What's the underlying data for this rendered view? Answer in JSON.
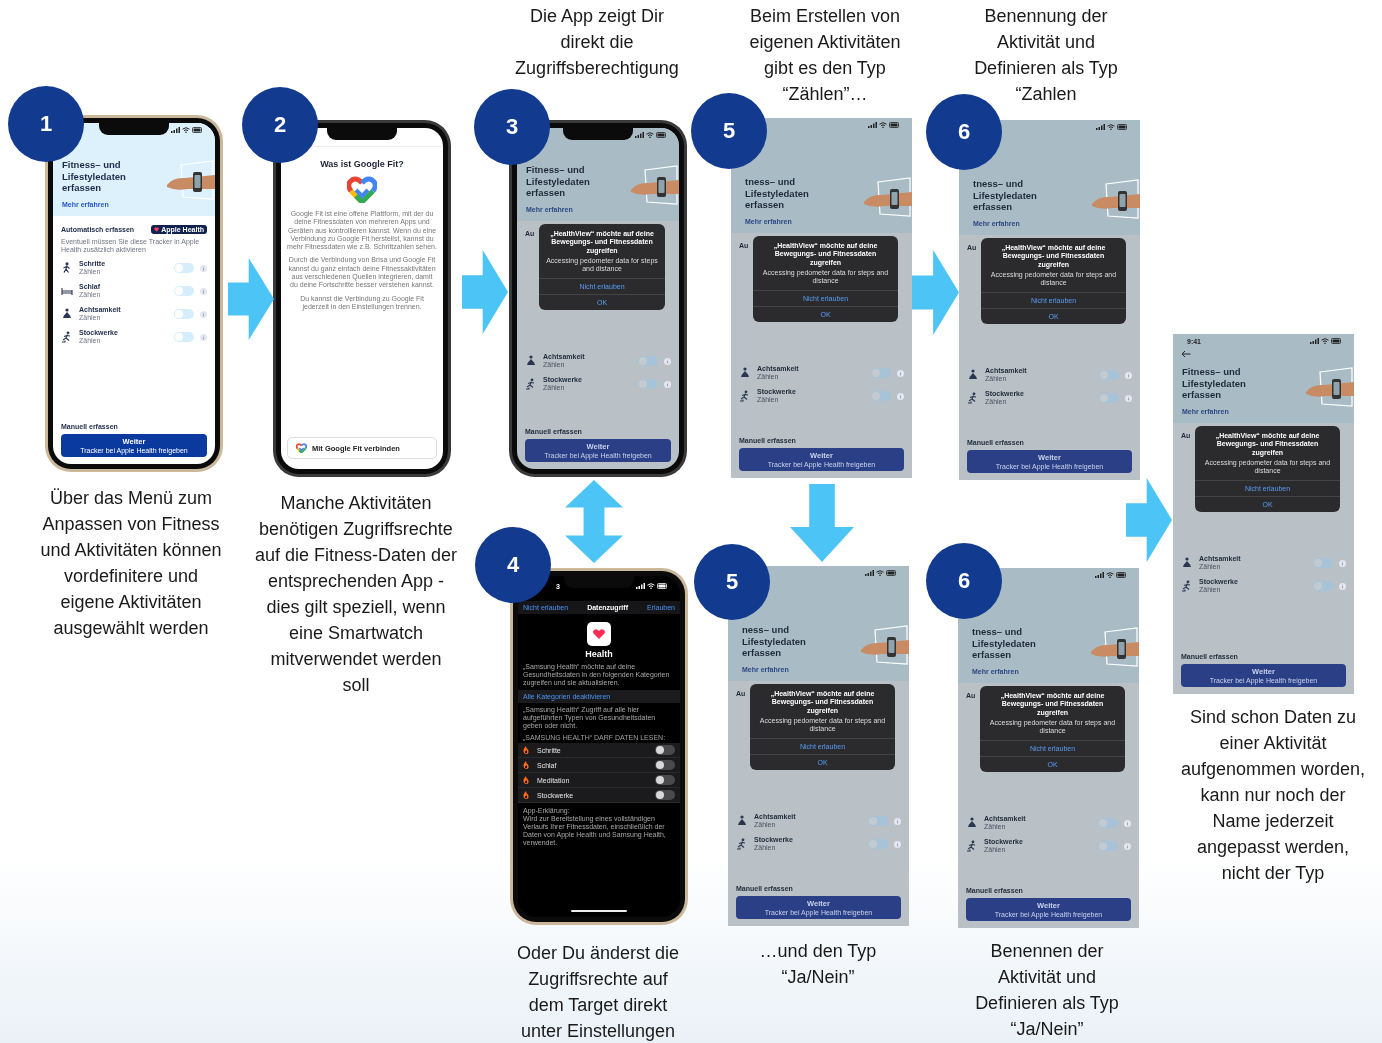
{
  "panels": [
    {
      "badge": "1",
      "caption": "Über das Menü zum\nAnpassen von Fitness\nund Aktivitäten können\nvordefinitere und\neigene Aktivitäten\nausgewählt werden",
      "screen": {
        "kind": "fitness",
        "frame": {
          "color": "#cbb89b"
        },
        "dimmed": false,
        "title": "Fitness– und\nLifestyledaten\nerfassen",
        "link": "Mehr erfahren",
        "auto_heading": "Automatisch erfassen",
        "auto_badge": "Apple Health",
        "auto_note": "Eventuell müssen Sie diese Tracker in Apple Health zusätzlich aktivieren",
        "rows": [
          {
            "kind": "steps",
            "name": "Schritte",
            "sub": "Zählen",
            "on": false
          },
          {
            "kind": "sleep",
            "name": "Schlaf",
            "sub": "Zählen",
            "on": false
          },
          {
            "kind": "mindfulness",
            "name": "Achtsamkeit",
            "sub": "Zählen",
            "on": false
          },
          {
            "kind": "floors",
            "name": "Stockwerke",
            "sub": "Zählen",
            "on": false
          }
        ],
        "manual": "Manuell erfassen",
        "button": "Weiter",
        "button_sub": "Tracker bei Apple Health freigeben"
      }
    },
    {
      "badge": "2",
      "caption": "Manche Aktivitäten\nbenötigen Zugriffsrechte\nauf die Fitness-Daten der\nentsprechenden App -\ndies gilt speziell, wenn\neine Smartwatch\nmitverwendet werden\nsoll",
      "screen": {
        "kind": "googlefit",
        "frame": {
          "color": "#3a3a3c"
        },
        "title": "Was ist Google Fit?",
        "paragraphs": [
          "Google Fit ist eine offene Plattform, mit der du deine Fitnessdaten von mehreren Apps und Geräten aus kontrollieren kannst. Wenn du eine Verbindung zu Google Fit herstellst, kannst du mehr Fitnessdaten wie z.B. Schrittzahlen sehen.",
          "Durch die Verbindung von Brisa und Google Fit kannst du ganz einfach deine Fitnessaktivitäten aus verschiedenen Quellen integrieren, damit du deine Fortschritte besser verstehen kannst.",
          "Du kannst die Verbindung zu Google Fit jederzeit in den Einstellungen trennen."
        ],
        "button": "Mit Google Fit verbinden"
      }
    },
    {
      "badge": "3",
      "caption": "Die App zeigt Dir\ndirekt die\nZugriffsberechtigung",
      "screen": {
        "kind": "fitness",
        "frame": {
          "color": "#3a3a3c"
        },
        "dimmed": true,
        "title": "Fitness– und\nLifestyledaten\nerfassen",
        "link": "Mehr erfahren",
        "auto_heading": "Au",
        "rows": [
          {
            "kind": "mindfulness",
            "name": "Achtsamkeit",
            "sub": "Zählen",
            "on": false
          },
          {
            "kind": "floors",
            "name": "Stockwerke",
            "sub": "Zählen",
            "on": false
          }
        ],
        "manual": "Manuell erfassen",
        "button": "Weiter",
        "button_sub": "Tracker bei Apple Health freigeben",
        "dialog": {
          "title": "„HealthView“ möchte auf deine Bewegungs- und Fitnessdaten zugreifen",
          "sub": "Accessing pedometer data for steps and distance",
          "actions": [
            "Nicht erlauben",
            "OK"
          ]
        }
      }
    },
    {
      "badge": "4",
      "caption": "Oder Du änderst die\nZugriffsrechte auf\ndem Target direkt\nunter Einstellungen",
      "screen": {
        "kind": "health",
        "frame": {
          "color": "#cbb89b"
        },
        "time": "3",
        "nav": [
          "Nicht erlauben",
          "Datenzugriff",
          "Erlauben"
        ],
        "app": "Health",
        "intro": "„Samsung Health“ möchte auf deine Gesundheitsdaten in den folgenden Kategorien zugreifen und sie aktualisieren.",
        "disable_all": "Alle Kategorien deaktivieren",
        "note": "„Samsung Health“ Zugriff auf alle hier aufgeführten Typen von Gesundheitsdaten geben oder nicht.",
        "section": "„SAMSUNG HEALTH“ DARF DATEN LESEN:",
        "rows": [
          {
            "name": "Schritte",
            "on": false
          },
          {
            "name": "Schlaf",
            "on": false
          },
          {
            "name": "Meditation",
            "on": false
          },
          {
            "name": "Stockwerke",
            "on": false
          }
        ],
        "explain_title": "App-Erklärung:",
        "explain": "Wird zur Bereitstellung eines vollständigen Verlaufs Ihrer Fitnessdaten, einschließlich der Daten von Apple Health und Samsung Health, verwendet."
      }
    },
    {
      "badge": "5",
      "caption": "Beim Erstellen von\neigenen Aktivitäten\ngibt es den Typ\n“Zählen”…",
      "screen": {
        "kind": "fitness",
        "dimmed": true,
        "title": "tness– und\nLifestyledaten\nerfassen",
        "link": "Mehr erfahren",
        "auto_heading": "Au",
        "rows": [
          {
            "kind": "mindfulness",
            "name": "Achtsamkeit",
            "sub": "Zählen",
            "on": false
          },
          {
            "kind": "floors",
            "name": "Stockwerke",
            "sub": "Zählen",
            "on": false
          }
        ],
        "manual": "Manuell erfassen",
        "button": "Weiter",
        "button_sub": "Tracker bei Apple Health freigeben",
        "dialog": {
          "title": "„HealthView“ möchte auf deine Bewegungs- und Fitnessdaten zugreifen",
          "sub": "Accessing pedometer data for steps and distance",
          "actions": [
            "Nicht erlauben",
            "OK"
          ]
        }
      }
    },
    {
      "badge": "6",
      "caption": "Benennung der\nAktivität und\nDefinieren als Typ\n“Zahlen",
      "screen": {
        "kind": "fitness",
        "dimmed": true,
        "title": "tness– und\nLifestyledaten\nerfassen",
        "link": "Mehr erfahren",
        "auto_heading": "Au",
        "rows": [
          {
            "kind": "mindfulness",
            "name": "Achtsamkeit",
            "sub": "Zählen",
            "on": false
          },
          {
            "kind": "floors",
            "name": "Stockwerke",
            "sub": "Zählen",
            "on": false
          }
        ],
        "manual": "Manuell erfassen",
        "button": "Weiter",
        "button_sub": "Tracker bei Apple Health freigeben",
        "dialog": {
          "title": "„HealthView“ möchte auf deine Bewegungs- und Fitnessdaten zugreifen",
          "sub": "Accessing pedometer data for steps and distance",
          "actions": [
            "Nicht erlauben",
            "OK"
          ]
        }
      }
    },
    {
      "badge": "5",
      "caption": "…und den Typ\n“Ja/Nein”",
      "screen": {
        "kind": "fitness",
        "dimmed": true,
        "title": "ness– und\nLifestyledaten\nerfassen",
        "link": "Mehr erfahren",
        "auto_heading": "Au",
        "rows": [
          {
            "kind": "mindfulness",
            "name": "Achtsamkeit",
            "sub": "Zählen",
            "on": false
          },
          {
            "kind": "floors",
            "name": "Stockwerke",
            "sub": "Zählen",
            "on": false
          }
        ],
        "manual": "Manuell erfassen",
        "button": "Weiter",
        "button_sub": "Tracker bei Apple Health freigeben",
        "dialog": {
          "title": "„HealthView“ möchte auf deine Bewegungs- und Fitnessdaten zugreifen",
          "sub": "Accessing pedometer data for steps and distance",
          "actions": [
            "Nicht erlauben",
            "OK"
          ]
        }
      }
    },
    {
      "badge": "6",
      "caption": "Benennen der\nAktivität und\nDefinieren als Typ\n“Ja/Nein”",
      "screen": {
        "kind": "fitness",
        "dimmed": true,
        "title": "tness– und\nLifestyledaten\nerfassen",
        "link": "Mehr erfahren",
        "auto_heading": "Au",
        "rows": [
          {
            "kind": "mindfulness",
            "name": "Achtsamkeit",
            "sub": "Zählen",
            "on": false
          },
          {
            "kind": "floors",
            "name": "Stockwerke",
            "sub": "Zählen",
            "on": false
          }
        ],
        "manual": "Manuell erfassen",
        "button": "Weiter",
        "button_sub": "Tracker bei Apple Health freigeben",
        "dialog": {
          "title": "„HealthView“ möchte auf deine Bewegungs- und Fitnessdaten zugreifen",
          "sub": "Accessing pedometer data for steps and distance",
          "actions": [
            "Nicht erlauben",
            "OK"
          ]
        }
      }
    },
    {
      "caption": "Sind schon Daten zu\neiner Aktivität\naufgenommen worden,\nkann nur noch der\nName jederzeit\nangepasst werden,\nnicht der Typ",
      "screen": {
        "kind": "fitness",
        "dimmed": true,
        "time": "9:41",
        "back": true,
        "title": "Fitness– und\nLifestyledaten\nerfassen",
        "link": "Mehr erfahren",
        "auto_heading": "Au",
        "rows": [
          {
            "kind": "mindfulness",
            "name": "Achtsamkeit",
            "sub": "Zählen",
            "on": false
          },
          {
            "kind": "floors",
            "name": "Stockwerke",
            "sub": "Zählen",
            "on": false
          }
        ],
        "manual": "Manuell erfassen",
        "button": "Weiter",
        "button_sub": "Tracker bei Apple Health freigeben",
        "dialog": {
          "title": "„HealthView“ möchte auf deine Bewegungs- und Fitnessdaten zugreifen",
          "sub": "Accessing pedometer data for steps and distance",
          "actions": [
            "Nicht erlauben",
            "OK"
          ]
        }
      }
    }
  ]
}
